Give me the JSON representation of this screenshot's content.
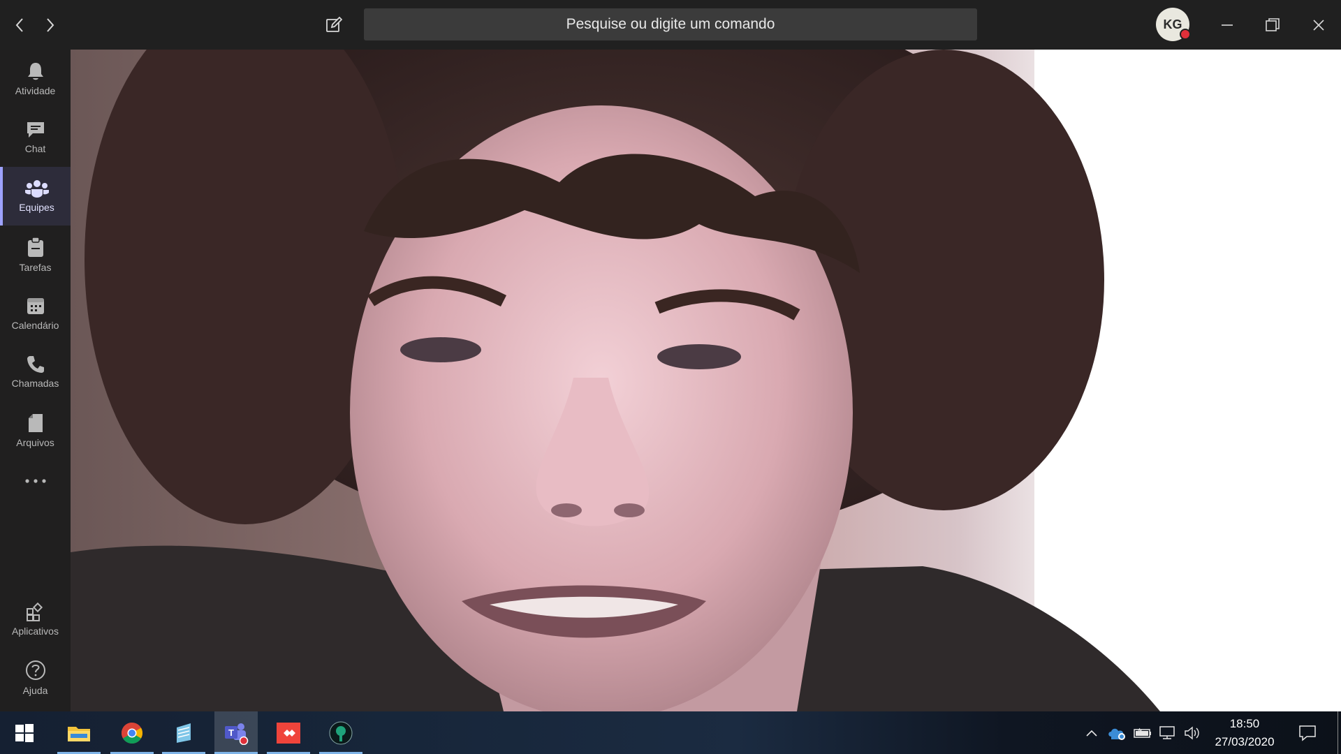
{
  "titlebar": {
    "search_placeholder": "Pesquise ou digite um comando",
    "avatar_initials": "KG",
    "avatar_bg": "#e9e8df",
    "presence_color": "#e0303a"
  },
  "rail": {
    "items": [
      {
        "label": "Atividade",
        "icon": "bell-icon"
      },
      {
        "label": "Chat",
        "icon": "chat-icon"
      },
      {
        "label": "Equipes",
        "icon": "teams-icon",
        "active": true
      },
      {
        "label": "Tarefas",
        "icon": "clipboard-icon"
      },
      {
        "label": "Calendário",
        "icon": "calendar-icon"
      },
      {
        "label": "Chamadas",
        "icon": "phone-icon"
      },
      {
        "label": "Arquivos",
        "icon": "file-icon"
      },
      {
        "label": "",
        "icon": "more-icon"
      }
    ],
    "bottom_items": [
      {
        "label": "Aplicativos",
        "icon": "apps-icon"
      },
      {
        "label": "Ajuda",
        "icon": "help-icon"
      }
    ],
    "accent_color": "#9ea2ff"
  },
  "taskbar": {
    "time": "18:50",
    "date": "27/03/2020",
    "apps": [
      "start-icon",
      "file-explorer-icon",
      "chrome-icon",
      "notepad-icon",
      "teams-icon",
      "anydesk-icon",
      "app-icon"
    ]
  }
}
